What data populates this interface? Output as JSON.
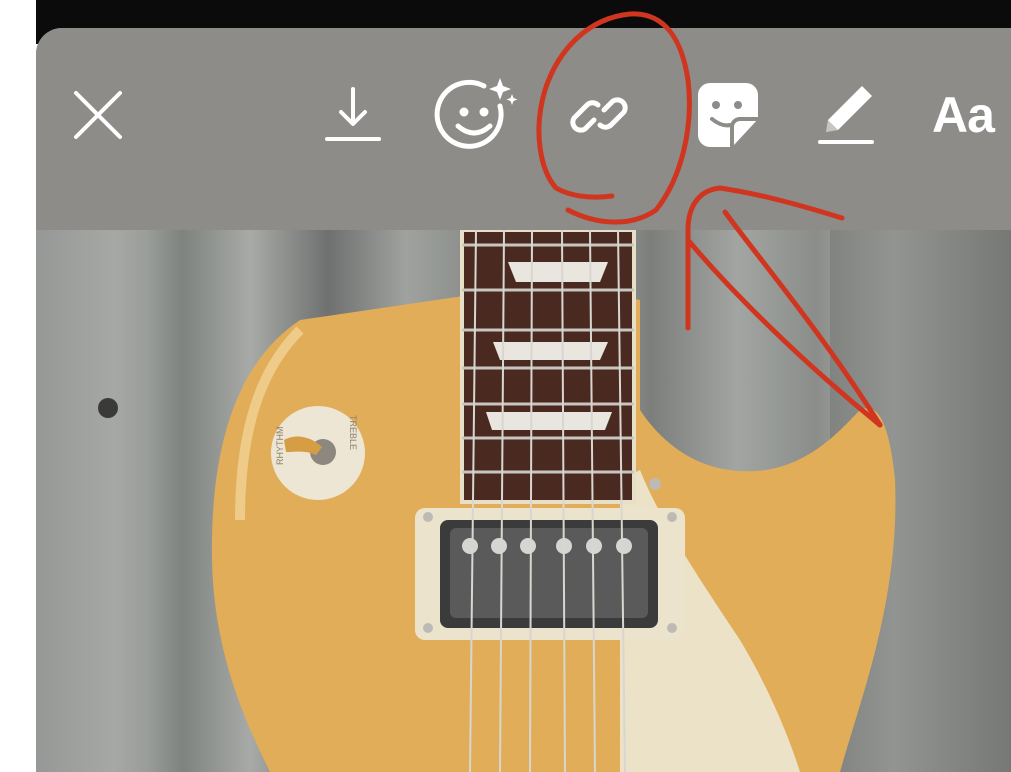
{
  "app": {
    "toolbar": {
      "text_tool_label": "Aa",
      "tools": [
        "close-icon",
        "download-icon",
        "effects-icon",
        "link-icon",
        "sticker-icon",
        "draw-icon",
        "text-tool"
      ]
    },
    "photo": {
      "selector_knob_label_left": "RHYTHM",
      "selector_knob_label_right": "TREBLE"
    },
    "colors": {
      "toolbar": "#8d8c88",
      "icon": "#ffffff",
      "annotation": "#d0361f",
      "guitar_top": "#e8b25a",
      "pickguard": "#efe6cf"
    }
  }
}
